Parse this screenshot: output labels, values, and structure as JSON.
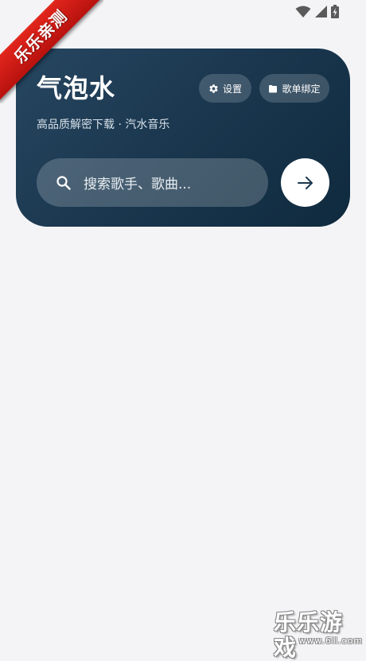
{
  "status_bar": {
    "icons": [
      "wifi-icon",
      "cell-signal-icon",
      "battery-charging-icon"
    ]
  },
  "header": {
    "title": "气泡水",
    "subtitle": "高品质解密下载 · 汽水音乐",
    "settings_button": {
      "label": "设置",
      "icon": "gear-icon"
    },
    "playlist_button": {
      "label": "歌单绑定",
      "icon": "folder-icon"
    },
    "search": {
      "placeholder": "搜索歌手、歌曲...",
      "icon": "search-icon",
      "submit_icon": "arrow-right-icon"
    }
  },
  "watermarks": {
    "corner_ribbon": "乐乐亲测",
    "bottom_title": "乐乐游戏",
    "bottom_url": "www.6ll.com"
  },
  "colors": {
    "background": "#f4f4f7",
    "card_dark": "#1b3850",
    "accent_text": "#ffffff",
    "ribbon_red": "#d41a14"
  }
}
